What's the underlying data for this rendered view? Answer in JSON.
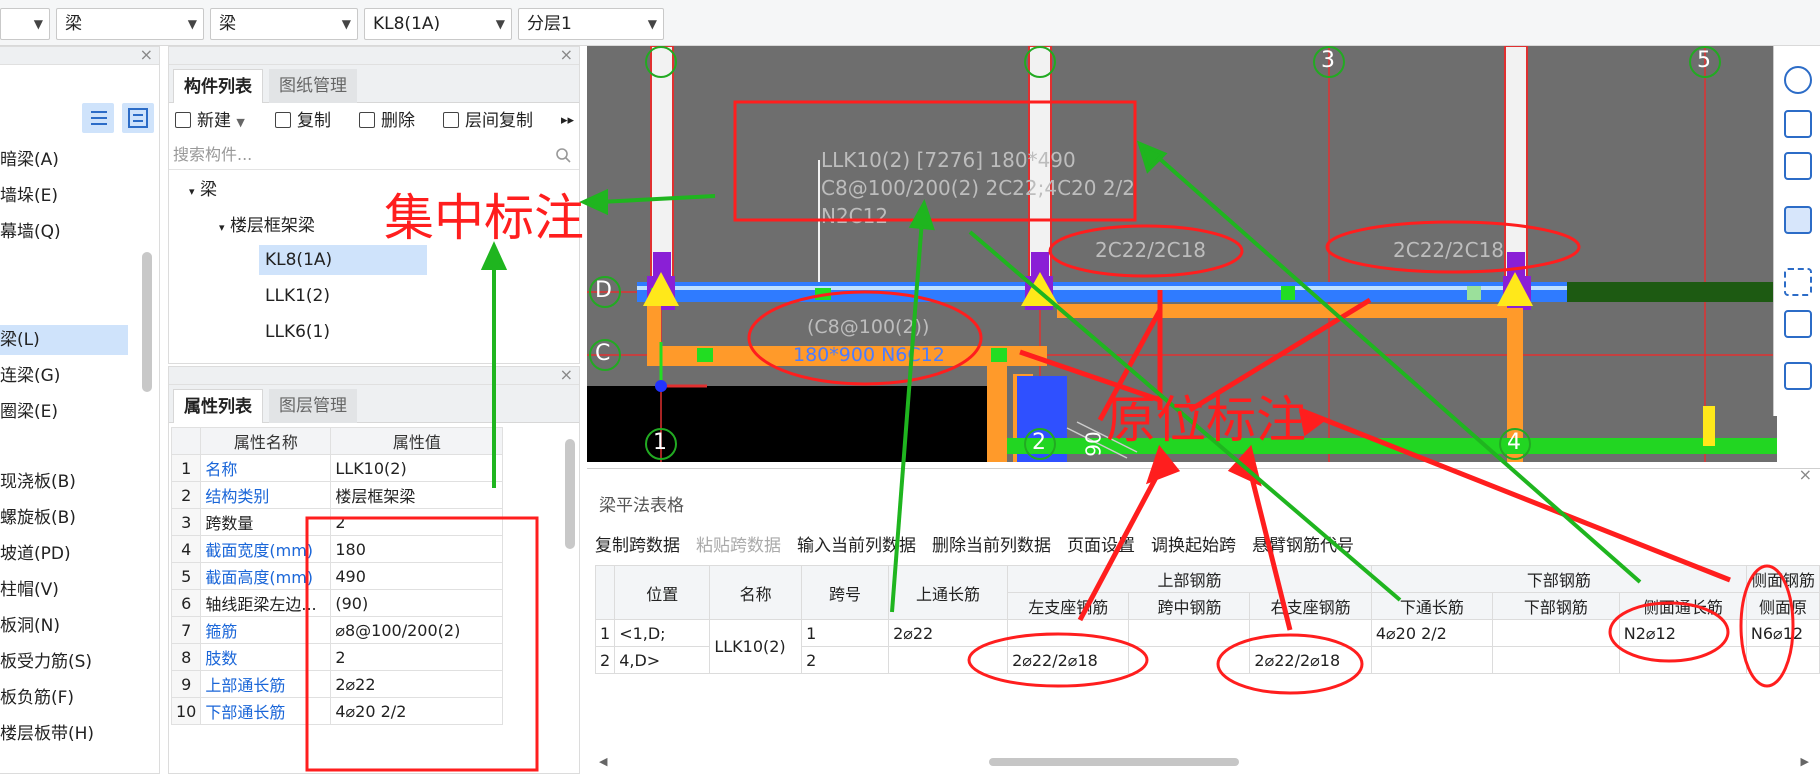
{
  "toolbar": {
    "combos": [
      "",
      "梁",
      "梁",
      "KL8(1A)",
      "分层1"
    ]
  },
  "left_nav": {
    "items": [
      "暗梁(A)",
      "墙垛(E)",
      "幕墙(Q)",
      "梁(L)",
      "连梁(G)",
      "圈梁(E)",
      "现浇板(B)",
      "螺旋板(B)",
      "坡道(PD)",
      "柱帽(V)",
      "板洞(N)",
      "板受力筋(S)",
      "板负筋(F)",
      "楼层板带(H)"
    ]
  },
  "component_panel": {
    "tabs": [
      "构件列表",
      "图纸管理"
    ],
    "tools": [
      "新建",
      "复制",
      "删除",
      "层间复制"
    ],
    "search_placeholder": "搜索构件...",
    "tree": {
      "root": "梁",
      "group": "楼层框架梁",
      "items": [
        "KL8(1A)",
        "LLK1(2)",
        "LLK6(1)"
      ]
    }
  },
  "property_panel": {
    "tabs": [
      "属性列表",
      "图层管理"
    ],
    "headers": [
      "属性名称",
      "属性值"
    ],
    "rows": [
      {
        "n": "1",
        "name": "名称",
        "value": "LLK10(2)"
      },
      {
        "n": "2",
        "name": "结构类别",
        "value": "楼层框架梁"
      },
      {
        "n": "3",
        "name": "跨数量",
        "value": "2"
      },
      {
        "n": "4",
        "name": "截面宽度(mm)",
        "value": "180"
      },
      {
        "n": "5",
        "name": "截面高度(mm)",
        "value": "490"
      },
      {
        "n": "6",
        "name": "轴线距梁左边...",
        "value": "(90)"
      },
      {
        "n": "7",
        "name": "箍筋",
        "value": "⌀8@100/200(2)"
      },
      {
        "n": "8",
        "name": "肢数",
        "value": "2"
      },
      {
        "n": "9",
        "name": "上部通长筋",
        "value": "2⌀22"
      },
      {
        "n": "10",
        "name": "下部通长筋",
        "value": "4⌀20 2/2"
      }
    ]
  },
  "cad": {
    "axis_labels": [
      "3",
      "5",
      "D",
      "C",
      "1",
      "2",
      "4"
    ],
    "concentrated_note": [
      "LLK10(2) [7276] 180*490",
      "C8@100/200(2) 2C22;4C20 2/2",
      "N2C12"
    ],
    "span_labels": [
      "2C22/2C18",
      "2C22/2C18"
    ],
    "inplace_note": [
      "(C8@100(2))",
      "180*900 N6C12"
    ],
    "dim_text": "90"
  },
  "bottom_panel": {
    "title": "梁平法表格",
    "tools": [
      "复制跨数据",
      "粘贴跨数据",
      "输入当前列数据",
      "删除当前列数据",
      "页面设置",
      "调换起始跨",
      "悬臂钢筋代号"
    ],
    "headers_top": [
      "位置",
      "名称",
      "跨号",
      "上通长筋",
      "上部钢筋",
      "下部钢筋",
      "侧面钢筋"
    ],
    "headers_sub": [
      "左支座钢筋",
      "跨中钢筋",
      "右支座钢筋",
      "下通长筋",
      "下部钢筋",
      "侧面通长筋",
      "侧面原"
    ],
    "rows": [
      {
        "idx": "1",
        "pos": "<1,D;",
        "name": "LLK10(2)",
        "span": "1",
        "top": "2⌀22",
        "left": "",
        "mid": "",
        "right": "",
        "bot_through": "4⌀20 2/2",
        "bot": "",
        "side": "N2⌀12",
        "side_orig": "N6⌀12"
      },
      {
        "idx": "2",
        "pos": "4,D>",
        "name": "",
        "span": "2",
        "top": "",
        "left": "2⌀22/2⌀18",
        "mid": "",
        "right": "2⌀22/2⌀18",
        "bot_through": "",
        "bot": "",
        "side": "",
        "side_orig": ""
      }
    ]
  },
  "annotations": {
    "concentrated": "集中标注",
    "inplace": "原位标注"
  },
  "colors": {
    "accent": "#1a66d8",
    "annotation_red": "#ff1e1e",
    "annotation_green": "#1fb51f",
    "cad_bg": "#6e6e6e"
  }
}
